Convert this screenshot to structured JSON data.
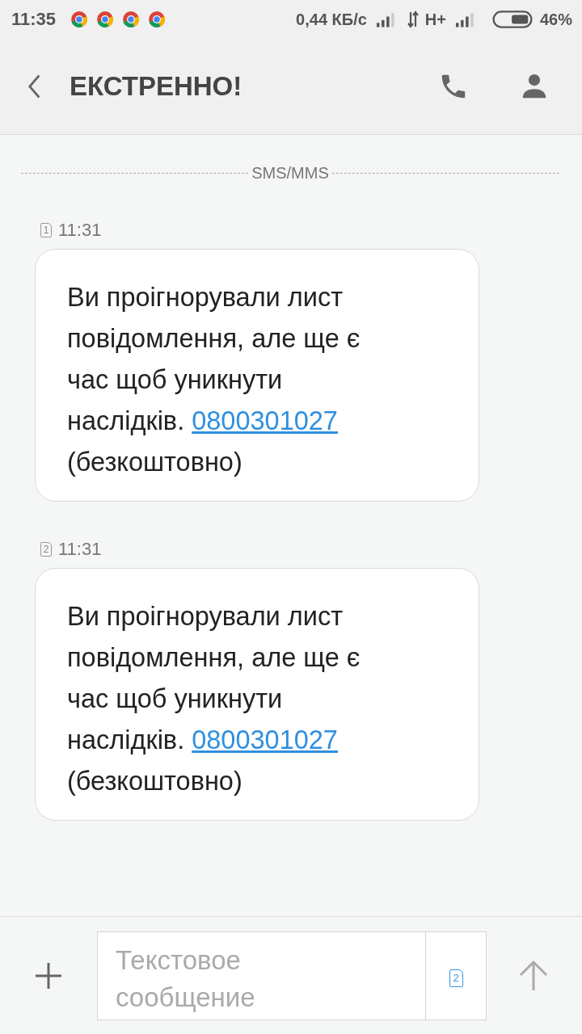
{
  "status_bar": {
    "time": "11:35",
    "notifications": [
      {
        "kind": "browser"
      },
      {
        "kind": "browser"
      },
      {
        "kind": "browser"
      },
      {
        "kind": "browser"
      }
    ],
    "speed": "0,44 КБ/с",
    "network": "H+",
    "battery": "46%"
  },
  "header": {
    "title": "ЕКСТРЕННО!"
  },
  "divider": "SMS/MMS",
  "messages": [
    {
      "sim": "1",
      "time": "11:31",
      "text": "Ви проігнорували лист повідомлення, але ще є час щоб уникнути наслідків.",
      "link": "0800301027",
      "text_after": "(безкоштовно)"
    },
    {
      "sim": "2",
      "time": "11:31",
      "text": "Ви проігнорували лист повідомлення, але ще є час щоб уникнути наслідків.",
      "link": "0800301027",
      "text_after": "(безкоштовно)"
    }
  ],
  "composer": {
    "placeholder": "Текстовое сообщение",
    "sim": "2"
  }
}
